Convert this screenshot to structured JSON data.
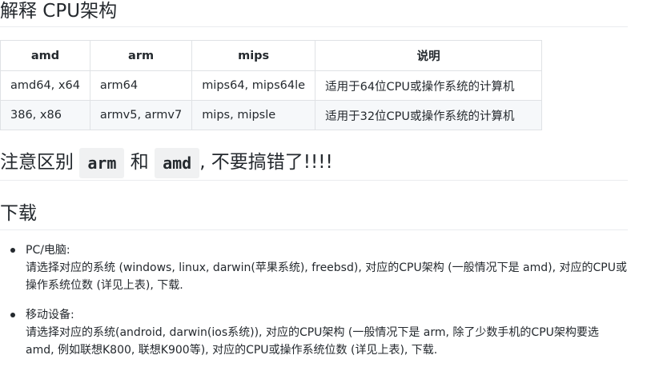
{
  "title": "解释 CPU架构",
  "table": {
    "headers": [
      "amd",
      "arm",
      "mips",
      "说明"
    ],
    "rows": [
      [
        "amd64, x64",
        "arm64",
        "mips64, mips64le",
        "适用于64位CPU或操作系统的计算机"
      ],
      [
        "386, x86",
        "armv5, armv7",
        "mips, mipsle",
        "适用于32位CPU或操作系统的计算机"
      ]
    ]
  },
  "note": {
    "prefix": "注意区别",
    "code1": "arm",
    "mid": "和",
    "code2": "amd",
    "suffix": ", 不要搞错了!!!!"
  },
  "download_heading": "下载",
  "items": [
    {
      "label": "PC/电脑:",
      "body": "请选择对应的系统 (windows, linux, darwin(苹果系统), freebsd), 对应的CPU架构 (一般情况下是 amd), 对应的CPU或操作系统位数 (详见上表), 下载."
    },
    {
      "label": "移动设备:",
      "body": "请选择对应的系统(android, darwin(ios系统)), 对应的CPU架构 (一般情况下是 arm, 除了少数手机的CPU架构要选 amd, 例如联想K800, 联想K900等), 对应的CPU或操作系统位数 (详见上表), 下载."
    }
  ]
}
